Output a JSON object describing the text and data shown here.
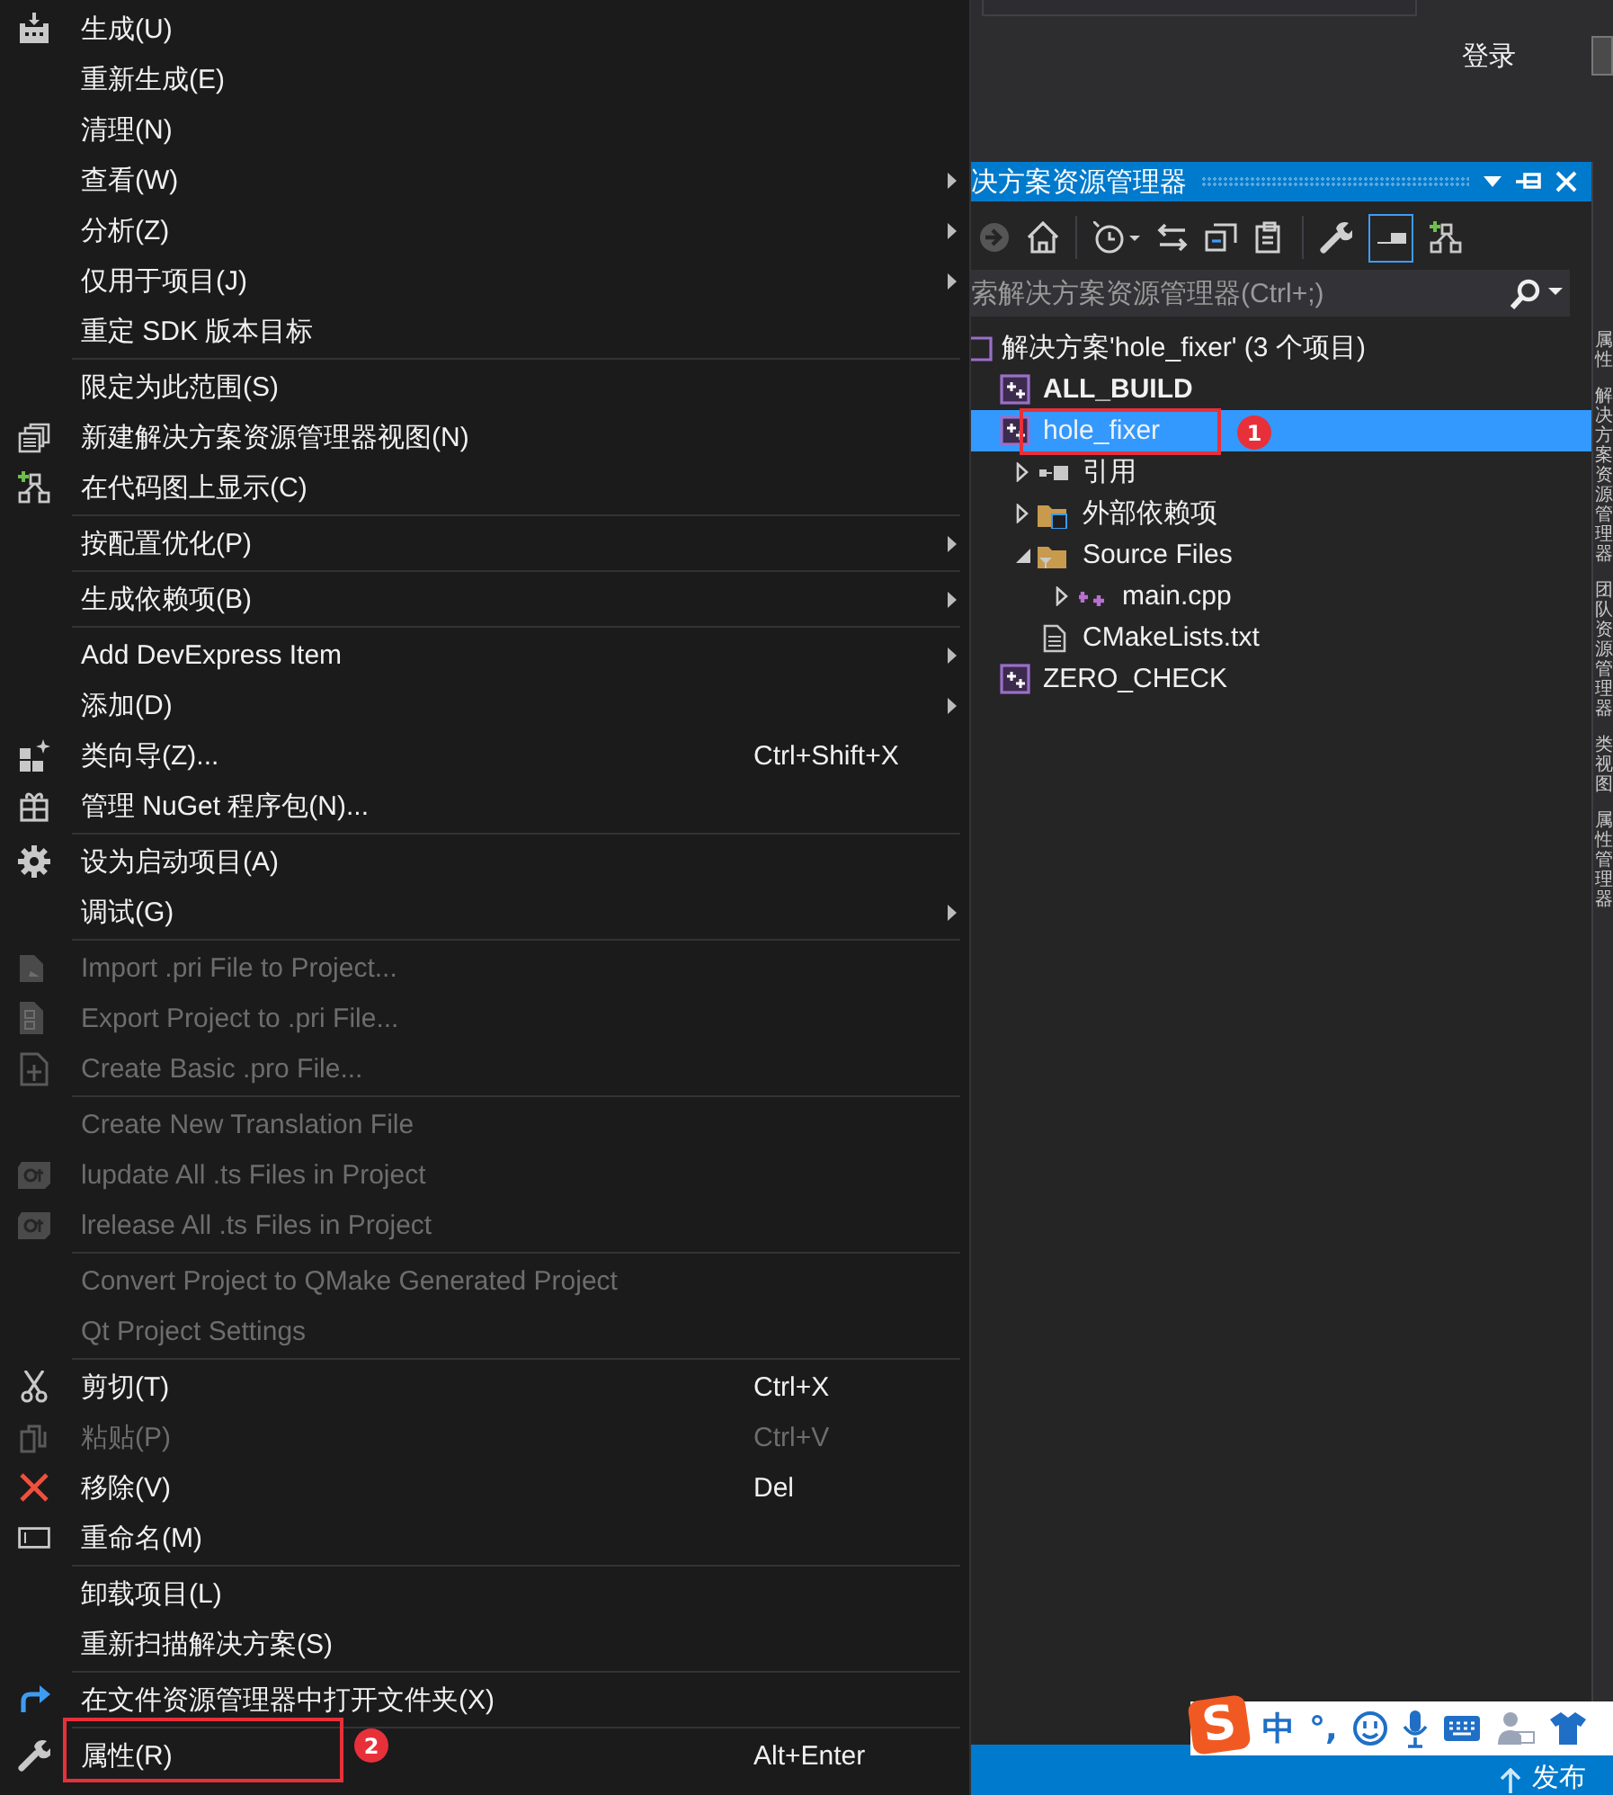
{
  "context_menu": {
    "groups": [
      [
        {
          "label": "生成(U)",
          "disabled": false
        },
        {
          "label": "重新生成(E)",
          "disabled": false
        },
        {
          "label": "清理(N)",
          "disabled": false
        },
        {
          "label": "查看(W)",
          "disabled": false,
          "submenu": true
        },
        {
          "label": "分析(Z)",
          "disabled": false,
          "submenu": true
        },
        {
          "label": "仅用于项目(J)",
          "disabled": false,
          "submenu": true
        },
        {
          "label": "重定 SDK 版本目标",
          "disabled": false
        }
      ],
      [
        {
          "label": "限定为此范围(S)",
          "disabled": false
        },
        {
          "label": "新建解决方案资源管理器视图(N)",
          "disabled": false
        },
        {
          "label": "在代码图上显示(C)",
          "disabled": false
        }
      ],
      [
        {
          "label": "按配置优化(P)",
          "disabled": false,
          "submenu": true
        }
      ],
      [
        {
          "label": "生成依赖项(B)",
          "disabled": false,
          "submenu": true
        }
      ],
      [
        {
          "label": "Add DevExpress Item",
          "disabled": false,
          "submenu": true
        },
        {
          "label": "添加(D)",
          "disabled": false,
          "submenu": true
        },
        {
          "label": "类向导(Z)...",
          "shortcut": "Ctrl+Shift+X",
          "disabled": false
        },
        {
          "label": "管理 NuGet 程序包(N)...",
          "disabled": false
        }
      ],
      [
        {
          "label": "设为启动项目(A)",
          "disabled": false
        },
        {
          "label": "调试(G)",
          "disabled": false,
          "submenu": true
        }
      ],
      [
        {
          "label": "Import .pri File to Project...",
          "disabled": true
        },
        {
          "label": "Export Project to .pri File...",
          "disabled": true
        },
        {
          "label": "Create Basic .pro File...",
          "disabled": true
        }
      ],
      [
        {
          "label": "Create New Translation File",
          "disabled": true
        },
        {
          "label": "lupdate All .ts Files in Project",
          "disabled": true
        },
        {
          "label": "lrelease All .ts Files in Project",
          "disabled": true
        }
      ],
      [
        {
          "label": "Convert Project to QMake Generated Project",
          "disabled": true
        },
        {
          "label": "Qt Project Settings",
          "disabled": true
        }
      ],
      [
        {
          "label": "剪切(T)",
          "shortcut": "Ctrl+X",
          "disabled": false
        },
        {
          "label": "粘贴(P)",
          "shortcut": "Ctrl+V",
          "disabled": true
        },
        {
          "label": "移除(V)",
          "shortcut": "Del",
          "disabled": false
        },
        {
          "label": "重命名(M)",
          "disabled": false
        }
      ],
      [
        {
          "label": "卸载项目(L)",
          "disabled": false
        },
        {
          "label": "重新扫描解决方案(S)",
          "disabled": false
        }
      ],
      [
        {
          "label": "在文件资源管理器中打开文件夹(X)",
          "disabled": false
        }
      ],
      [
        {
          "label": "属性(R)",
          "shortcut": "Alt+Enter",
          "disabled": false
        }
      ]
    ]
  },
  "title_bar": {
    "sign_in": "登录"
  },
  "solution_explorer": {
    "title": "决方案资源管理器",
    "search": {
      "placeholder": "索解决方案资源管理器(Ctrl+;)"
    },
    "tree": [
      {
        "label": "解决方案'hole_fixer' (3 个项目)",
        "kind": "solution",
        "bold": false,
        "selected": false,
        "children": [
          {
            "label": "ALL_BUILD",
            "kind": "project",
            "bold": true,
            "selected": false
          },
          {
            "label": "hole_fixer",
            "kind": "project",
            "bold": false,
            "selected": true,
            "children": [
              {
                "label": "引用",
                "kind": "references",
                "bold": false,
                "selected": false,
                "expanded": false
              },
              {
                "label": "外部依赖项",
                "kind": "external",
                "bold": false,
                "selected": false,
                "expanded": false
              },
              {
                "label": "Source Files",
                "kind": "filter",
                "bold": false,
                "selected": false,
                "expanded": true,
                "children": [
                  {
                    "label": "main.cpp",
                    "kind": "cpp",
                    "bold": false,
                    "selected": false,
                    "expanded": false
                  }
                ]
              },
              {
                "label": "CMakeLists.txt",
                "kind": "textfile",
                "bold": false,
                "selected": false
              }
            ]
          },
          {
            "label": "ZERO_CHECK",
            "kind": "project",
            "bold": false,
            "selected": false
          }
        ]
      }
    ]
  },
  "side_tabs": [
    "属性",
    "解决方案资源管理器",
    "团队资源管理器",
    "类视图",
    "属性管理器"
  ],
  "annotations": [
    {
      "label": "1"
    },
    {
      "label": "2"
    }
  ],
  "ime_bar": {
    "logo": "S",
    "mode": "中",
    "punctuation": "°,"
  },
  "status_bar": {
    "publish": "发布"
  }
}
